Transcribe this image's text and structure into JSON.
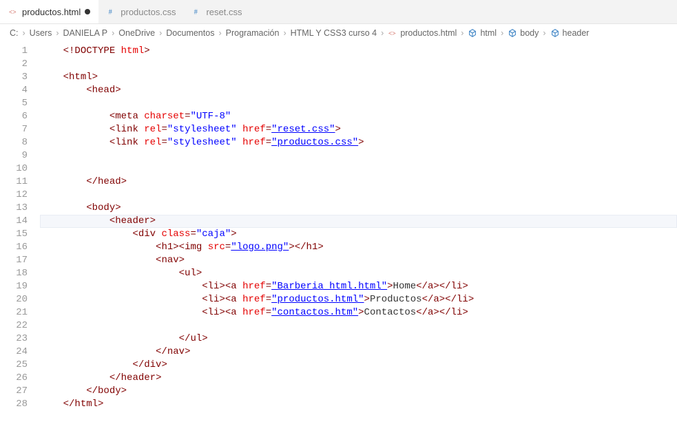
{
  "tabs": [
    {
      "label": "productos.html",
      "icon": "html",
      "modified": true,
      "active": true
    },
    {
      "label": "productos.css",
      "icon": "css",
      "modified": false,
      "active": false
    },
    {
      "label": "reset.css",
      "icon": "css",
      "modified": false,
      "active": false
    }
  ],
  "breadcrumb": {
    "path": [
      "C:",
      "Users",
      "DANIELA P",
      "OneDrive",
      "Documentos",
      "Programación",
      "HTML Y CSS3 curso 4"
    ],
    "file": "productos.html",
    "symbols": [
      "html",
      "body",
      "header"
    ]
  },
  "code": {
    "total_lines": 28,
    "current_line": 14,
    "lines": [
      {
        "n": 1,
        "indent": 1,
        "tokens": [
          {
            "t": "punc",
            "v": "<!"
          },
          {
            "t": "tag",
            "v": "DOCTYPE"
          },
          {
            "t": "text",
            "v": " "
          },
          {
            "t": "attr",
            "v": "html"
          },
          {
            "t": "punc",
            "v": ">"
          }
        ]
      },
      {
        "n": 2,
        "indent": 0,
        "tokens": []
      },
      {
        "n": 3,
        "indent": 1,
        "tokens": [
          {
            "t": "punc",
            "v": "<"
          },
          {
            "t": "tag",
            "v": "html"
          },
          {
            "t": "punc",
            "v": ">"
          }
        ]
      },
      {
        "n": 4,
        "indent": 2,
        "tokens": [
          {
            "t": "punc",
            "v": "<"
          },
          {
            "t": "tag",
            "v": "head"
          },
          {
            "t": "punc",
            "v": ">"
          }
        ]
      },
      {
        "n": 5,
        "indent": 0,
        "tokens": []
      },
      {
        "n": 6,
        "indent": 3,
        "tokens": [
          {
            "t": "punc",
            "v": "<"
          },
          {
            "t": "tag",
            "v": "meta"
          },
          {
            "t": "text",
            "v": " "
          },
          {
            "t": "attr",
            "v": "charset"
          },
          {
            "t": "punc",
            "v": "="
          },
          {
            "t": "str",
            "v": "\"UTF-8\""
          }
        ]
      },
      {
        "n": 7,
        "indent": 3,
        "tokens": [
          {
            "t": "punc",
            "v": "<"
          },
          {
            "t": "tag",
            "v": "link"
          },
          {
            "t": "text",
            "v": " "
          },
          {
            "t": "attr",
            "v": "rel"
          },
          {
            "t": "punc",
            "v": "="
          },
          {
            "t": "str",
            "v": "\"stylesheet\""
          },
          {
            "t": "text",
            "v": " "
          },
          {
            "t": "attr",
            "v": "href"
          },
          {
            "t": "punc",
            "v": "="
          },
          {
            "t": "strlink",
            "v": "\"reset.css\""
          },
          {
            "t": "punc",
            "v": ">"
          }
        ]
      },
      {
        "n": 8,
        "indent": 3,
        "tokens": [
          {
            "t": "punc",
            "v": "<"
          },
          {
            "t": "tag",
            "v": "link"
          },
          {
            "t": "text",
            "v": " "
          },
          {
            "t": "attr",
            "v": "rel"
          },
          {
            "t": "punc",
            "v": "="
          },
          {
            "t": "str",
            "v": "\"stylesheet\""
          },
          {
            "t": "text",
            "v": " "
          },
          {
            "t": "attr",
            "v": "href"
          },
          {
            "t": "punc",
            "v": "="
          },
          {
            "t": "strlink",
            "v": "\"productos.css\""
          },
          {
            "t": "punc",
            "v": ">"
          }
        ]
      },
      {
        "n": 9,
        "indent": 0,
        "tokens": []
      },
      {
        "n": 10,
        "indent": 0,
        "tokens": []
      },
      {
        "n": 11,
        "indent": 2,
        "tokens": [
          {
            "t": "punc",
            "v": "</"
          },
          {
            "t": "tag",
            "v": "head"
          },
          {
            "t": "punc",
            "v": ">"
          }
        ]
      },
      {
        "n": 12,
        "indent": 0,
        "tokens": []
      },
      {
        "n": 13,
        "indent": 2,
        "tokens": [
          {
            "t": "punc",
            "v": "<"
          },
          {
            "t": "tag",
            "v": "body"
          },
          {
            "t": "punc",
            "v": ">"
          }
        ]
      },
      {
        "n": 14,
        "indent": 3,
        "tokens": [
          {
            "t": "punc",
            "v": "<"
          },
          {
            "t": "tag",
            "v": "header"
          },
          {
            "t": "punc",
            "v": ">"
          }
        ]
      },
      {
        "n": 15,
        "indent": 4,
        "tokens": [
          {
            "t": "punc",
            "v": "<"
          },
          {
            "t": "tag",
            "v": "div"
          },
          {
            "t": "text",
            "v": " "
          },
          {
            "t": "attr",
            "v": "class"
          },
          {
            "t": "punc",
            "v": "="
          },
          {
            "t": "str",
            "v": "\"caja\""
          },
          {
            "t": "punc",
            "v": ">"
          }
        ]
      },
      {
        "n": 16,
        "indent": 5,
        "tokens": [
          {
            "t": "punc",
            "v": "<"
          },
          {
            "t": "tag",
            "v": "h1"
          },
          {
            "t": "punc",
            "v": "><"
          },
          {
            "t": "tag",
            "v": "img"
          },
          {
            "t": "text",
            "v": " "
          },
          {
            "t": "attr",
            "v": "src"
          },
          {
            "t": "punc",
            "v": "="
          },
          {
            "t": "strlink",
            "v": "\"logo.png\""
          },
          {
            "t": "punc",
            "v": "></"
          },
          {
            "t": "tag",
            "v": "h1"
          },
          {
            "t": "punc",
            "v": ">"
          }
        ]
      },
      {
        "n": 17,
        "indent": 5,
        "tokens": [
          {
            "t": "punc",
            "v": "<"
          },
          {
            "t": "tag",
            "v": "nav"
          },
          {
            "t": "punc",
            "v": ">"
          }
        ]
      },
      {
        "n": 18,
        "indent": 6,
        "tokens": [
          {
            "t": "punc",
            "v": "<"
          },
          {
            "t": "tag",
            "v": "ul"
          },
          {
            "t": "punc",
            "v": ">"
          }
        ]
      },
      {
        "n": 19,
        "indent": 7,
        "tokens": [
          {
            "t": "punc",
            "v": "<"
          },
          {
            "t": "tag",
            "v": "li"
          },
          {
            "t": "punc",
            "v": "><"
          },
          {
            "t": "tag",
            "v": "a"
          },
          {
            "t": "text",
            "v": " "
          },
          {
            "t": "attr",
            "v": "href"
          },
          {
            "t": "punc",
            "v": "="
          },
          {
            "t": "strlink",
            "v": "\"Barberia_html.html\""
          },
          {
            "t": "punc",
            "v": ">"
          },
          {
            "t": "text",
            "v": "Home"
          },
          {
            "t": "punc",
            "v": "</"
          },
          {
            "t": "tag",
            "v": "a"
          },
          {
            "t": "punc",
            "v": "></"
          },
          {
            "t": "tag",
            "v": "li"
          },
          {
            "t": "punc",
            "v": ">"
          }
        ]
      },
      {
        "n": 20,
        "indent": 7,
        "tokens": [
          {
            "t": "punc",
            "v": "<"
          },
          {
            "t": "tag",
            "v": "li"
          },
          {
            "t": "punc",
            "v": "><"
          },
          {
            "t": "tag",
            "v": "a"
          },
          {
            "t": "text",
            "v": " "
          },
          {
            "t": "attr",
            "v": "href"
          },
          {
            "t": "punc",
            "v": "="
          },
          {
            "t": "strlink",
            "v": "\"productos.html\""
          },
          {
            "t": "punc",
            "v": ">"
          },
          {
            "t": "text",
            "v": "Productos"
          },
          {
            "t": "punc",
            "v": "</"
          },
          {
            "t": "tag",
            "v": "a"
          },
          {
            "t": "punc",
            "v": "></"
          },
          {
            "t": "tag",
            "v": "li"
          },
          {
            "t": "punc",
            "v": ">"
          }
        ]
      },
      {
        "n": 21,
        "indent": 7,
        "tokens": [
          {
            "t": "punc",
            "v": "<"
          },
          {
            "t": "tag",
            "v": "li"
          },
          {
            "t": "punc",
            "v": "><"
          },
          {
            "t": "tag",
            "v": "a"
          },
          {
            "t": "text",
            "v": " "
          },
          {
            "t": "attr",
            "v": "href"
          },
          {
            "t": "punc",
            "v": "="
          },
          {
            "t": "strlink",
            "v": "\"contactos.htm\""
          },
          {
            "t": "punc",
            "v": ">"
          },
          {
            "t": "text",
            "v": "Contactos"
          },
          {
            "t": "punc",
            "v": "</"
          },
          {
            "t": "tag",
            "v": "a"
          },
          {
            "t": "punc",
            "v": "></"
          },
          {
            "t": "tag",
            "v": "li"
          },
          {
            "t": "punc",
            "v": ">"
          }
        ]
      },
      {
        "n": 22,
        "indent": 0,
        "tokens": []
      },
      {
        "n": 23,
        "indent": 6,
        "tokens": [
          {
            "t": "punc",
            "v": "</"
          },
          {
            "t": "tag",
            "v": "ul"
          },
          {
            "t": "punc",
            "v": ">"
          }
        ]
      },
      {
        "n": 24,
        "indent": 5,
        "tokens": [
          {
            "t": "punc",
            "v": "</"
          },
          {
            "t": "tag",
            "v": "nav"
          },
          {
            "t": "punc",
            "v": ">"
          }
        ]
      },
      {
        "n": 25,
        "indent": 4,
        "tokens": [
          {
            "t": "punc",
            "v": "</"
          },
          {
            "t": "tag",
            "v": "div"
          },
          {
            "t": "punc",
            "v": ">"
          }
        ]
      },
      {
        "n": 26,
        "indent": 3,
        "tokens": [
          {
            "t": "punc",
            "v": "</"
          },
          {
            "t": "tag",
            "v": "header"
          },
          {
            "t": "punc",
            "v": ">"
          }
        ]
      },
      {
        "n": 27,
        "indent": 2,
        "tokens": [
          {
            "t": "punc",
            "v": "</"
          },
          {
            "t": "tag",
            "v": "body"
          },
          {
            "t": "punc",
            "v": ">"
          }
        ]
      },
      {
        "n": 28,
        "indent": 1,
        "tokens": [
          {
            "t": "punc",
            "v": "</"
          },
          {
            "t": "tag",
            "v": "html"
          },
          {
            "t": "punc",
            "v": ">"
          }
        ]
      }
    ]
  }
}
